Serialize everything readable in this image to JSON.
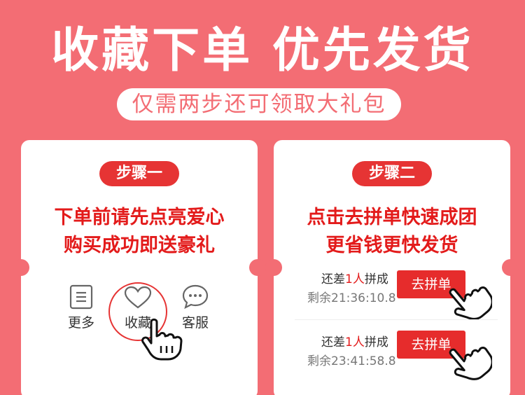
{
  "headline": "收藏下单 优先发货",
  "subtitle": "仅需两步还可领取大礼包",
  "step1": {
    "badge": "步骤一",
    "line1": "下单前请先点亮爱心",
    "line2": "购买成功即送豪礼",
    "icons": {
      "more": "更多",
      "favorite": "收藏",
      "service": "客服"
    }
  },
  "step2": {
    "badge": "步骤二",
    "line1": "点击去拼单快速成团",
    "line2": "更省钱更快发货",
    "rows": [
      {
        "prefix": "还差",
        "count": "1人",
        "suffix": "拼成",
        "timer": "剩余21:36:10.8",
        "button": "去拼单"
      },
      {
        "prefix": "还差",
        "count": "1人",
        "suffix": "拼成",
        "timer": "剩余23:41:58.8",
        "button": "去拼单"
      }
    ]
  },
  "colors": {
    "background": "#f36d74",
    "accent_red": "#e63434",
    "text_red": "#e31b1b",
    "card": "#ffffff"
  }
}
